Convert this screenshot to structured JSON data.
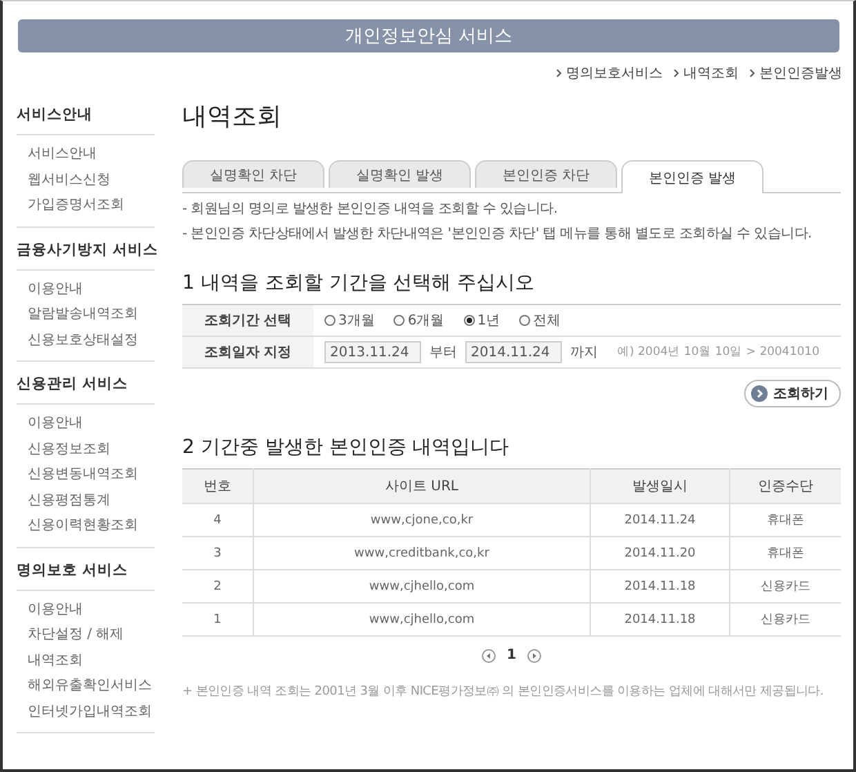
{
  "header": {
    "title": "개인정보안심 서비스"
  },
  "breadcrumb": [
    "명의보호서비스",
    "내역조회",
    "본인인증발생"
  ],
  "sidebar": [
    {
      "title": "서비스안내",
      "items": [
        "서비스안내",
        "웹서비스신청",
        "가입증명서조회"
      ]
    },
    {
      "title": "금융사기방지 서비스",
      "items": [
        "이용안내",
        "알람발송내역조회",
        "신용보호상태설정"
      ]
    },
    {
      "title": "신용관리 서비스",
      "items": [
        "이용안내",
        "신용정보조회",
        "신용변동내역조회",
        "신용평점통계",
        "신용이력현황조회"
      ]
    },
    {
      "title": "명의보호 서비스",
      "items": [
        "이용안내",
        "차단설정 / 해제",
        "내역조회",
        "해외유출확인서비스",
        "인터넷가입내역조회"
      ]
    }
  ],
  "page_title": "내역조회",
  "tabs": [
    {
      "label": "실명확인 차단",
      "selected": false
    },
    {
      "label": "실명확인 발생",
      "selected": false
    },
    {
      "label": "본인인증 차단",
      "selected": false
    },
    {
      "label": "본인인증 발생",
      "selected": true
    }
  ],
  "notes": [
    "- 회원님의 명의로 발생한 본인인증 내역을 조회할 수 있습니다.",
    "- 본인인증 차단상태에서 발생한 차단내역은 '본인인증 차단' 탭 메뉴를 통해 별도로 조회하실 수 있습니다."
  ],
  "section1": {
    "title": "1 내역을 조회할 기간을 선택해 주십시오",
    "period_label": "조회기간 선택",
    "periods": [
      {
        "label": "3개월",
        "selected": false
      },
      {
        "label": "6개월",
        "selected": false
      },
      {
        "label": "1년",
        "selected": true
      },
      {
        "label": "전체",
        "selected": false
      }
    ],
    "date_label": "조회일자 지정",
    "from": "2013.11.24",
    "from_suffix": "부터",
    "to": "2014.11.24",
    "to_suffix": "까지",
    "example": "예) 2004년 10월 10일 > 20041010",
    "search_button": "조회하기"
  },
  "section2": {
    "title": "2 기간중 발생한 본인인증 내역입니다",
    "columns": [
      "번호",
      "사이트 URL",
      "발생일시",
      "인증수단"
    ],
    "rows": [
      [
        "4",
        "www,cjone,co,kr",
        "2014.11.24",
        "휴대폰"
      ],
      [
        "3",
        "www,creditbank,co,kr",
        "2014.11.20",
        "휴대폰"
      ],
      [
        "2",
        "www,cjhello,com",
        "2014.11.18",
        "신용카드"
      ],
      [
        "1",
        "www,cjhello,com",
        "2014.11.18",
        "신용카드"
      ]
    ],
    "page": "1"
  },
  "footnote": "+ 본인인증 내역 조회는 2001년 3월 이후 NICE평가정보㈜ 의 본인인증서비스를 이용하는 업체에 대해서만 제공됩니다."
}
